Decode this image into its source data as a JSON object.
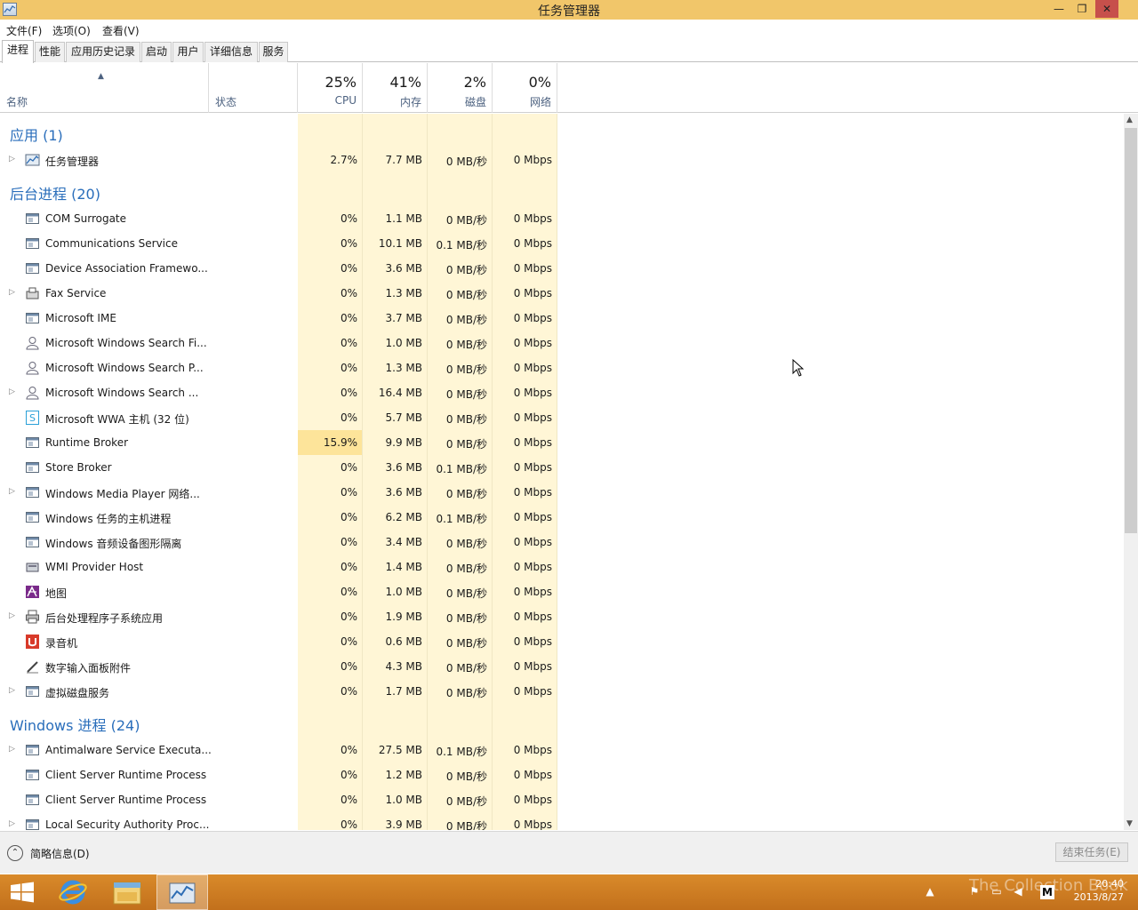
{
  "window": {
    "title": "任务管理器",
    "controls": {
      "minimize": "—",
      "maximize": "❐",
      "close": "✕"
    }
  },
  "menu": [
    "文件(F)",
    "选项(O)",
    "查看(V)"
  ],
  "tabs": [
    "进程",
    "性能",
    "应用历史记录",
    "启动",
    "用户",
    "详细信息",
    "服务"
  ],
  "active_tab": "进程",
  "columns": {
    "name": "名称",
    "status": "状态",
    "cpu": {
      "pct": "25%",
      "label": "CPU"
    },
    "memory": {
      "pct": "41%",
      "label": "内存"
    },
    "disk": {
      "pct": "2%",
      "label": "磁盘"
    },
    "network": {
      "pct": "0%",
      "label": "网络"
    }
  },
  "groups": [
    {
      "title": "应用 (1)",
      "rows": [
        {
          "name": "任务管理器",
          "icon": "task-manager-icon",
          "expandable": true,
          "cpu": "2.7%",
          "mem": "7.7 MB",
          "disk": "0 MB/秒",
          "net": "0 Mbps"
        }
      ]
    },
    {
      "title": "后台进程 (20)",
      "rows": [
        {
          "name": "COM Surrogate",
          "icon": "window-icon",
          "expandable": false,
          "cpu": "0%",
          "mem": "1.1 MB",
          "disk": "0 MB/秒",
          "net": "0 Mbps"
        },
        {
          "name": "Communications Service",
          "icon": "window-icon",
          "expandable": false,
          "cpu": "0%",
          "mem": "10.1 MB",
          "disk": "0.1 MB/秒",
          "net": "0 Mbps"
        },
        {
          "name": "Device Association Framewo...",
          "icon": "window-icon",
          "expandable": false,
          "cpu": "0%",
          "mem": "3.6 MB",
          "disk": "0 MB/秒",
          "net": "0 Mbps"
        },
        {
          "name": "Fax Service",
          "icon": "fax-icon",
          "expandable": true,
          "cpu": "0%",
          "mem": "1.3 MB",
          "disk": "0 MB/秒",
          "net": "0 Mbps"
        },
        {
          "name": "Microsoft IME",
          "icon": "window-icon",
          "expandable": false,
          "cpu": "0%",
          "mem": "3.7 MB",
          "disk": "0 MB/秒",
          "net": "0 Mbps"
        },
        {
          "name": "Microsoft Windows Search Fi...",
          "icon": "user-icon",
          "expandable": false,
          "cpu": "0%",
          "mem": "1.0 MB",
          "disk": "0 MB/秒",
          "net": "0 Mbps"
        },
        {
          "name": "Microsoft Windows Search P...",
          "icon": "user-icon",
          "expandable": false,
          "cpu": "0%",
          "mem": "1.3 MB",
          "disk": "0 MB/秒",
          "net": "0 Mbps"
        },
        {
          "name": "Microsoft Windows Search ...",
          "icon": "user-icon",
          "expandable": true,
          "cpu": "0%",
          "mem": "16.4 MB",
          "disk": "0 MB/秒",
          "net": "0 Mbps"
        },
        {
          "name": "Microsoft WWA 主机 (32 位)",
          "icon": "skype-icon",
          "expandable": false,
          "cpu": "0%",
          "mem": "5.7 MB",
          "disk": "0 MB/秒",
          "net": "0 Mbps"
        },
        {
          "name": "Runtime Broker",
          "icon": "window-icon",
          "expandable": false,
          "cpu": "15.9%",
          "cpu_highlight": true,
          "mem": "9.9 MB",
          "disk": "0 MB/秒",
          "net": "0 Mbps"
        },
        {
          "name": "Store Broker",
          "icon": "window-icon",
          "expandable": false,
          "cpu": "0%",
          "mem": "3.6 MB",
          "disk": "0.1 MB/秒",
          "net": "0 Mbps"
        },
        {
          "name": "Windows Media Player 网络...",
          "icon": "window-icon",
          "expandable": true,
          "cpu": "0%",
          "mem": "3.6 MB",
          "disk": "0 MB/秒",
          "net": "0 Mbps"
        },
        {
          "name": "Windows 任务的主机进程",
          "icon": "window-icon",
          "expandable": false,
          "cpu": "0%",
          "mem": "6.2 MB",
          "disk": "0.1 MB/秒",
          "net": "0 Mbps"
        },
        {
          "name": "Windows 音频设备图形隔离",
          "icon": "window-icon",
          "expandable": false,
          "cpu": "0%",
          "mem": "3.4 MB",
          "disk": "0 MB/秒",
          "net": "0 Mbps"
        },
        {
          "name": "WMI Provider Host",
          "icon": "wmi-icon",
          "expandable": false,
          "cpu": "0%",
          "mem": "1.4 MB",
          "disk": "0 MB/秒",
          "net": "0 Mbps"
        },
        {
          "name": "地图",
          "icon": "maps-icon",
          "expandable": false,
          "cpu": "0%",
          "mem": "1.0 MB",
          "disk": "0 MB/秒",
          "net": "0 Mbps"
        },
        {
          "name": "后台处理程序子系统应用",
          "icon": "printer-icon",
          "expandable": true,
          "cpu": "0%",
          "mem": "1.9 MB",
          "disk": "0 MB/秒",
          "net": "0 Mbps"
        },
        {
          "name": "录音机",
          "icon": "recorder-icon",
          "expandable": false,
          "cpu": "0%",
          "mem": "0.6 MB",
          "disk": "0 MB/秒",
          "net": "0 Mbps"
        },
        {
          "name": "数字输入面板附件",
          "icon": "pen-icon",
          "expandable": false,
          "cpu": "0%",
          "mem": "4.3 MB",
          "disk": "0 MB/秒",
          "net": "0 Mbps"
        },
        {
          "name": "虚拟磁盘服务",
          "icon": "window-icon",
          "expandable": true,
          "cpu": "0%",
          "mem": "1.7 MB",
          "disk": "0 MB/秒",
          "net": "0 Mbps"
        }
      ]
    },
    {
      "title": "Windows 进程 (24)",
      "rows": [
        {
          "name": "Antimalware Service Executa...",
          "icon": "window-icon",
          "expandable": true,
          "cpu": "0%",
          "mem": "27.5 MB",
          "disk": "0.1 MB/秒",
          "net": "0 Mbps"
        },
        {
          "name": "Client Server Runtime Process",
          "icon": "window-icon",
          "expandable": false,
          "cpu": "0%",
          "mem": "1.2 MB",
          "disk": "0 MB/秒",
          "net": "0 Mbps"
        },
        {
          "name": "Client Server Runtime Process",
          "icon": "window-icon",
          "expandable": false,
          "cpu": "0%",
          "mem": "1.0 MB",
          "disk": "0 MB/秒",
          "net": "0 Mbps"
        },
        {
          "name": "Local Security Authority Proc...",
          "icon": "window-icon",
          "expandable": true,
          "cpu": "0%",
          "mem": "3.9 MB",
          "disk": "0 MB/秒",
          "net": "0 Mbps"
        }
      ]
    }
  ],
  "footer": {
    "fewer_details": "简略信息(D)",
    "end_task": "结束任务(E)"
  },
  "taskbar": {
    "watermark": "The Collection Book",
    "time": "20:40",
    "date": "2013/8/27",
    "ime": "M"
  },
  "colors": {
    "titlebar": "#f1c66a",
    "group_title": "#2a6ebb",
    "cell_bg": "#fff6d6",
    "cell_highlight": "#fde49a",
    "taskbar": "#c97820"
  }
}
